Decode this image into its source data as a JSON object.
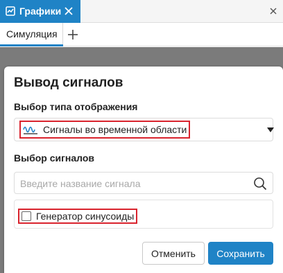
{
  "window": {
    "tab_title": "Графики",
    "app_icon": "chart-app-icon",
    "tab_close_icon": "close-icon",
    "window_close_icon": "close-icon"
  },
  "tabs": {
    "active_label": "Симуляция",
    "add_icon": "plus-icon"
  },
  "dialog": {
    "title": "Вывод сигналов",
    "display_type": {
      "label": "Выбор типа отображения",
      "selected": "Сигналы во временной области",
      "icon": "waveform-icon",
      "dropdown_icon": "caret-down-icon"
    },
    "signals": {
      "label": "Выбор сигналов",
      "search_placeholder": "Введите название сигнала",
      "search_value": "",
      "search_icon": "search-icon",
      "items": [
        {
          "label": "Генератор синусоиды",
          "checked": false
        }
      ]
    },
    "buttons": {
      "cancel": "Отменить",
      "save": "Сохранить"
    }
  },
  "colors": {
    "accent": "#1f83c6",
    "highlight": "#d9232d",
    "overlay": "#7b7b7b"
  }
}
